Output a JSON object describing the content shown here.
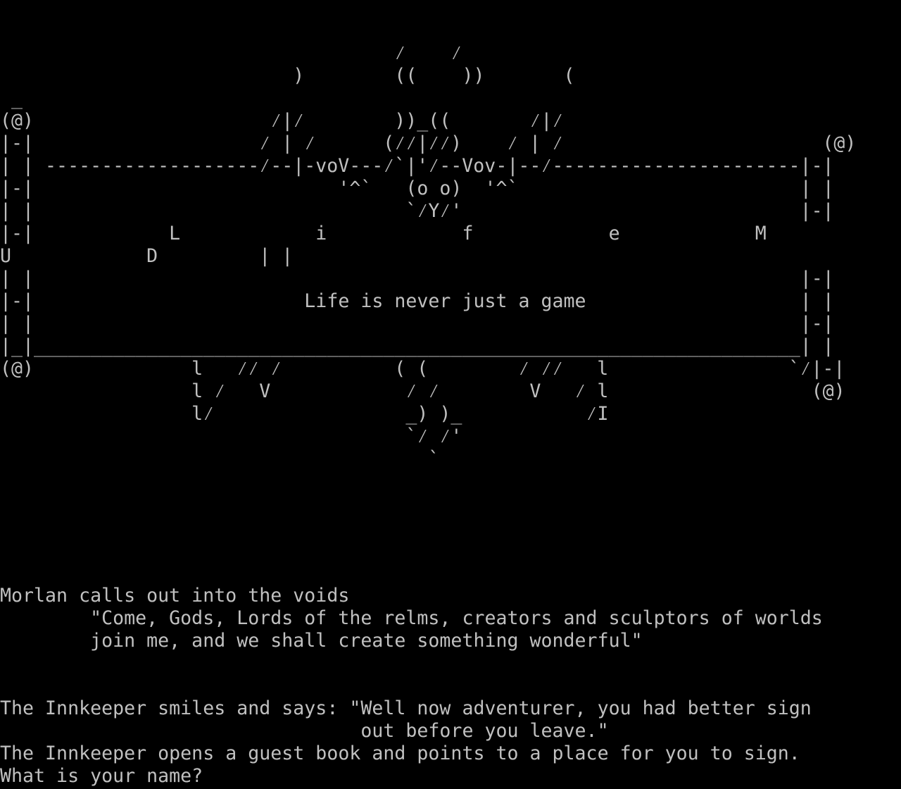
{
  "colors": {
    "background": "#000000",
    "text": "#c0c0c0"
  },
  "banner": {
    "lines": [
      "                                   ⁄    ⁄",
      "                          )        ((    ))       (",
      " _",
      "(@)                     ⁄|⁄        ))_((       ⁄|⁄",
      "|-|                    ⁄ | ⁄      (⁄⁄|⁄⁄)    ⁄ | ⁄                       (@)",
      "| | -------------------⁄--|-voV---⁄`|'⁄--Vov-|--⁄----------------------|-|",
      "|-|                           '^`   (o o)  '^`                         | |",
      "| |                                 `⁄Y⁄'                              |-|",
      "|-|            L            i            f            e            M",
      "U            D         | |",
      "| |                                                                    |-|",
      "|-|                        Life is never just a game                   | |",
      "| |                                                                    |-|",
      "|_|____________________________________________________________________| |",
      "(@)              l   ⁄⁄ ⁄          ( (        ⁄ ⁄⁄   l                `⁄|-|",
      "                 l ⁄   V            ⁄ ⁄        V   ⁄ l                  (@)",
      "                 l⁄                 _) )_           ⁄I",
      "                                    `⁄ ⁄'",
      "                                      `"
    ]
  },
  "story": {
    "lines": [
      "Morlan calls out into the voids",
      "        \"Come, Gods, Lords of the relms, creators and sculptors of worlds",
      "        join me, and we shall create something wonderful\"",
      "",
      "",
      "The Innkeeper smiles and says: \"Well now adventurer, you had better sign",
      "                                out before you leave.\"",
      "The Innkeeper opens a guest book and points to a place for you to sign."
    ]
  },
  "prompt": {
    "text": "What is your name? "
  }
}
